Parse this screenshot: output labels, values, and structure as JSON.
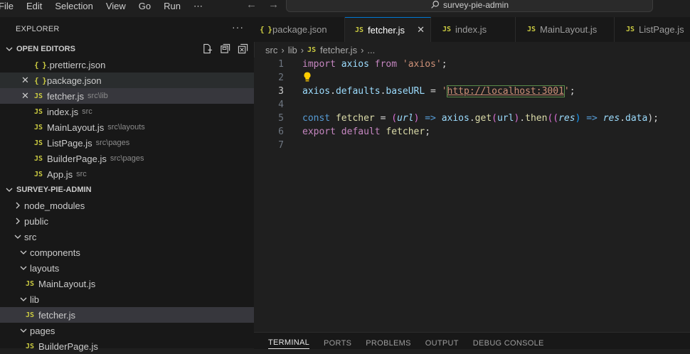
{
  "menu": [
    "File",
    "Edit",
    "Selection",
    "View",
    "Go",
    "Run",
    "⋯"
  ],
  "search": {
    "label": "survey-pie-admin"
  },
  "explorer": {
    "title": "EXPLORER",
    "more": "···",
    "open_editors_title": "OPEN EDITORS",
    "open_editors": [
      {
        "icon": "{ }",
        "name": ".prettierrc.json",
        "desc": "",
        "close": ""
      },
      {
        "icon": "{ }",
        "name": "package.json",
        "desc": "",
        "close": "✕"
      },
      {
        "icon": "JS",
        "name": "fetcher.js",
        "desc": "src\\lib",
        "close": "✕"
      },
      {
        "icon": "JS",
        "name": "index.js",
        "desc": "src",
        "close": ""
      },
      {
        "icon": "JS",
        "name": "MainLayout.js",
        "desc": "src\\layouts",
        "close": ""
      },
      {
        "icon": "JS",
        "name": "ListPage.js",
        "desc": "src\\pages",
        "close": ""
      },
      {
        "icon": "JS",
        "name": "BuilderPage.js",
        "desc": "src\\pages",
        "close": ""
      },
      {
        "icon": "JS",
        "name": "App.js",
        "desc": "src",
        "close": ""
      }
    ],
    "project_title": "SURVEY-PIE-ADMIN",
    "tree": [
      {
        "kind": "folder",
        "name": "node_modules",
        "chev": "›"
      },
      {
        "kind": "folder",
        "name": "public",
        "chev": "›"
      },
      {
        "kind": "folder",
        "name": "src",
        "chev": "⌄"
      },
      {
        "kind": "folder",
        "name": "components",
        "chev": "⌄"
      },
      {
        "kind": "folder",
        "name": "layouts",
        "chev": "⌄"
      },
      {
        "kind": "file",
        "name": "MainLayout.js",
        "icon": "JS"
      },
      {
        "kind": "folder",
        "name": "lib",
        "chev": "⌄"
      },
      {
        "kind": "file",
        "name": "fetcher.js",
        "icon": "JS"
      },
      {
        "kind": "folder",
        "name": "pages",
        "chev": "⌄"
      },
      {
        "kind": "file",
        "name": "BuilderPage.js",
        "icon": "JS"
      }
    ]
  },
  "tabs": [
    {
      "icon": "{ }",
      "label": "package.json"
    },
    {
      "icon": "JS",
      "label": "fetcher.js",
      "close": "✕"
    },
    {
      "icon": "JS",
      "label": "index.js"
    },
    {
      "icon": "JS",
      "label": "MainLayout.js"
    },
    {
      "icon": "JS",
      "label": "ListPage.js"
    }
  ],
  "breadcrumb": {
    "seg1": "src",
    "seg2": "lib",
    "icon": "JS",
    "file": "fetcher.js",
    "tail": "..."
  },
  "editor": {
    "line_numbers": [
      "1",
      "2",
      "3",
      "4",
      "5",
      "6",
      "7"
    ],
    "line1": {
      "kw": "import",
      "name": "axios",
      "from": "from",
      "str": "'axios'",
      "end": ";"
    },
    "line3": {
      "obj": "axios",
      "p1": "defaults",
      "p2": "baseURL",
      "eq": " = ",
      "q1": "'",
      "url": "http://localhost:3001",
      "q2": "'",
      "end": ";"
    },
    "line5": {
      "kw": "const",
      "name": "fetcher",
      "eq": " = ",
      "p_open": "(",
      "param": "url",
      "p_close": ")",
      "arrow": " => ",
      "obj": "axios",
      "dot": ".",
      "get": "get",
      "a_open": "(",
      "arg": "url",
      "a_close": ")",
      "then": "then",
      "t_open": "((",
      "res": "res",
      "t_close": ")",
      "arrow2": " => ",
      "res2": "res",
      "data": "data",
      "end": ");"
    },
    "line6": {
      "kw": "export",
      "kw2": "default",
      "name": "fetcher",
      "end": ";"
    }
  },
  "panel_tabs": [
    "TERMINAL",
    "PORTS",
    "PROBLEMS",
    "OUTPUT",
    "DEBUG CONSOLE"
  ]
}
